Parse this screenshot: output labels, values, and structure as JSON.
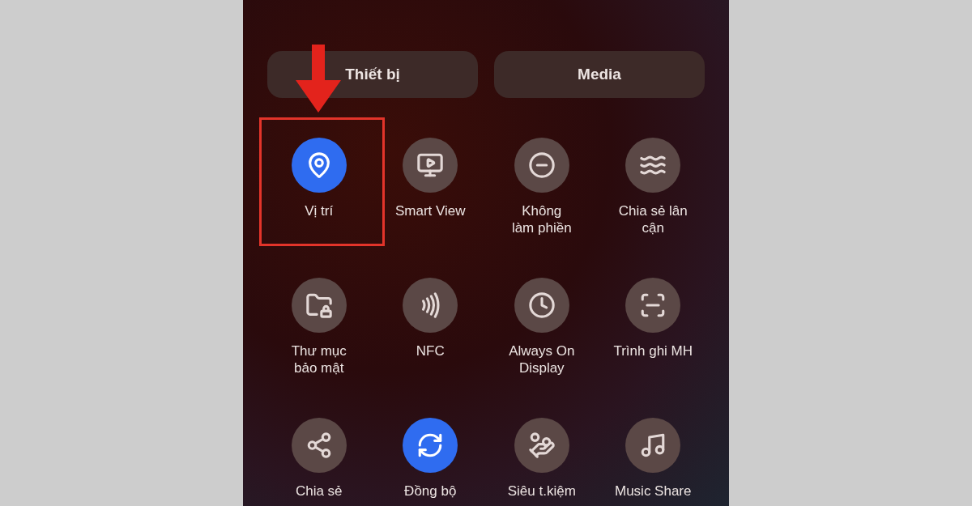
{
  "tabs": [
    {
      "label": "Thiết bị",
      "selected": false
    },
    {
      "label": "Media",
      "selected": false
    }
  ],
  "tiles": [
    {
      "label": [
        "Vị trí"
      ],
      "on": true,
      "highlighted": true
    },
    {
      "label": [
        "Smart View"
      ],
      "on": false,
      "highlighted": false
    },
    {
      "label": [
        "Không",
        "làm phiền"
      ],
      "on": false,
      "highlighted": false
    },
    {
      "label": [
        "Chia sẻ lân",
        "cận"
      ],
      "on": false,
      "highlighted": false
    },
    {
      "label": [
        "Thư mục",
        "bảo mật"
      ],
      "on": false,
      "highlighted": false
    },
    {
      "label": [
        "NFC"
      ],
      "on": false,
      "highlighted": false
    },
    {
      "label": [
        "Always On",
        "Display"
      ],
      "on": false,
      "highlighted": false
    },
    {
      "label": [
        "Trình ghi MH"
      ],
      "on": false,
      "highlighted": false
    },
    {
      "label": [
        "Chia sẻ"
      ],
      "on": false,
      "highlighted": false
    },
    {
      "label": [
        "Đồng bộ"
      ],
      "on": true,
      "highlighted": false
    },
    {
      "label": [
        "Siêu t.kiệm"
      ],
      "on": false,
      "highlighted": false
    },
    {
      "label": [
        "Music Share"
      ],
      "on": false,
      "highlighted": false
    }
  ]
}
